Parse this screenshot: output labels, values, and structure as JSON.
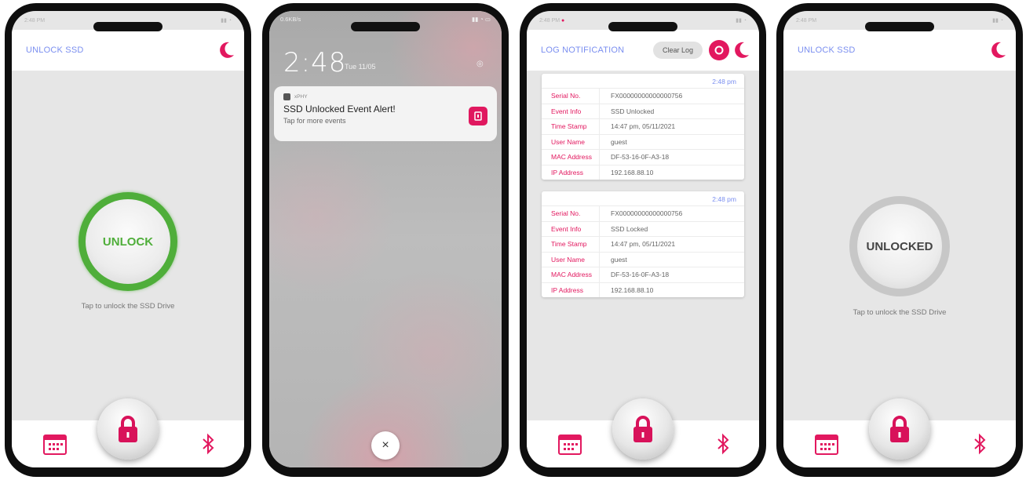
{
  "colors": {
    "accent": "#e2185f",
    "title_blue": "#7b8ff0",
    "green": "#4fae3a",
    "grey_ring": "#c7c7c7"
  },
  "screen1": {
    "app_title": "UNLOCK SSD",
    "button_label": "UNLOCK",
    "hint": "Tap to unlock the SSD Drive"
  },
  "screen2": {
    "time": "2:48",
    "date": "Tue 11/05",
    "status_left": "0.6KB/s",
    "notification": {
      "app_name": "xPHY",
      "title": "SSD Unlocked Event Alert!",
      "subtitle": "Tap for more events"
    },
    "close_icon": "×"
  },
  "screen3": {
    "app_title": "LOG NOTIFICATION",
    "clear_label": "Clear Log",
    "logs": [
      {
        "time": "2:48 pm",
        "rows": [
          {
            "k": "Serial No.",
            "v": "FX00000000000000756"
          },
          {
            "k": "Event Info",
            "v": "SSD Unlocked"
          },
          {
            "k": "Time Stamp",
            "v": "14:47 pm, 05/11/2021"
          },
          {
            "k": "User Name",
            "v": "guest"
          },
          {
            "k": "MAC Address",
            "v": "DF-53-16-0F-A3-18"
          },
          {
            "k": "IP Address",
            "v": "192.168.88.10"
          }
        ]
      },
      {
        "time": "2:48 pm",
        "rows": [
          {
            "k": "Serial No.",
            "v": "FX00000000000000756"
          },
          {
            "k": "Event Info",
            "v": "SSD Locked"
          },
          {
            "k": "Time Stamp",
            "v": "14:47 pm, 05/11/2021"
          },
          {
            "k": "User Name",
            "v": "guest"
          },
          {
            "k": "MAC Address",
            "v": "DF-53-16-0F-A3-18"
          },
          {
            "k": "IP Address",
            "v": "192.168.88.10"
          }
        ]
      }
    ]
  },
  "screen4": {
    "app_title": "UNLOCK SSD",
    "button_label": "UNLOCKED",
    "hint": "Tap to unlock the SSD Drive"
  },
  "icons": {
    "moon": "moon-icon",
    "calendar": "calendar-icon",
    "bluetooth": "bluetooth-icon",
    "lock": "padlock-icon",
    "refresh": "refresh-icon",
    "close": "close-icon"
  }
}
